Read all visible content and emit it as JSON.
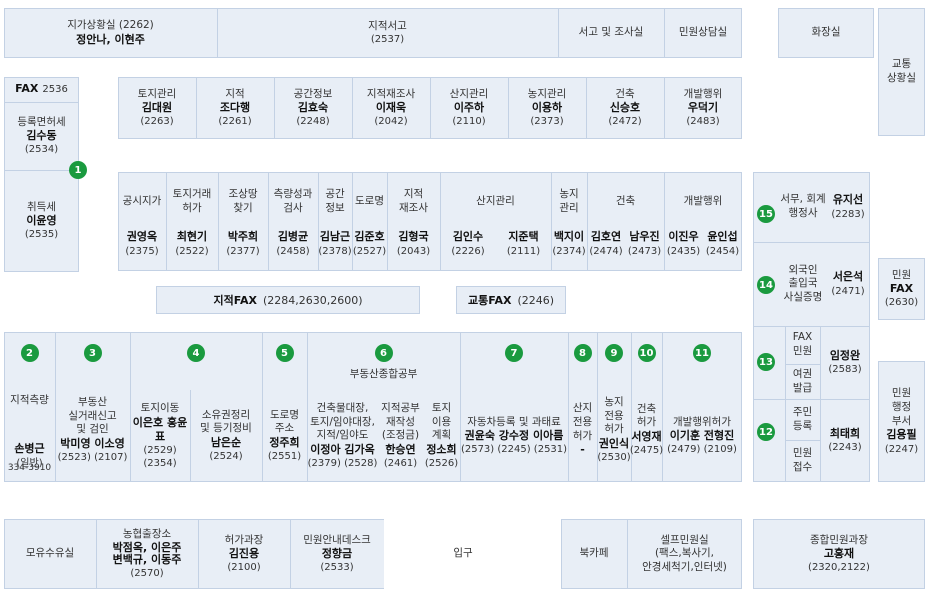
{
  "top": {
    "c1": {
      "label": "지가상황실 (2262)",
      "names": "정안나, 이현주"
    },
    "c2": {
      "label": "지적서고",
      "phone": "(2537)"
    },
    "c3": {
      "label": "서고 및 조사실"
    },
    "c4": {
      "label": "민원상담실"
    },
    "restroom": "화장실",
    "traffic": "교통\n상황실"
  },
  "left": {
    "fax": {
      "title": "FAX",
      "num": "2536"
    },
    "reg": {
      "label": "등록면허세",
      "name": "김수동",
      "phone": "(2534)"
    },
    "acq": {
      "label": "취득세",
      "name": "이윤영",
      "phone": "(2535)"
    },
    "badge": "1"
  },
  "row2": [
    {
      "label": "토지관리",
      "name": "김대원",
      "phone": "(2263)"
    },
    {
      "label": "지적",
      "name": "조다행",
      "phone": "(2261)"
    },
    {
      "label": "공간정보",
      "name": "김효숙",
      "phone": "(2248)"
    },
    {
      "label": "지적재조사",
      "name": "이재욱",
      "phone": "(2042)"
    },
    {
      "label": "산지관리",
      "name": "이주하",
      "phone": "(2110)"
    },
    {
      "label": "농지관리",
      "name": "이용하",
      "phone": "(2373)"
    },
    {
      "label": "건축",
      "name": "신승호",
      "phone": "(2472)"
    },
    {
      "label": "개발행위",
      "name": "우덕기",
      "phone": "(2483)"
    }
  ],
  "row3": {
    "heads": [
      "공시지가",
      "토지거래\n허가",
      "조상땅\n찾기",
      "측량성과\n검사",
      "공간\n정보",
      "도로명",
      "지적\n재조사",
      "산지관리",
      "농지\n관리",
      "건축",
      "개발행위"
    ],
    "names": [
      "권영옥",
      "최현기",
      "박주희",
      "김병균",
      "김남근",
      "김준호",
      "김형국",
      "김인수",
      "지준택",
      "백지이",
      "김호연",
      "남우진",
      "이진우",
      "윤인섭"
    ],
    "phones": [
      "(2375)",
      "(2522)",
      "(2377)",
      "(2458)",
      "(2378)",
      "(2527)",
      "(2043)",
      "(2226)",
      "(2111)",
      "(2374)",
      "(2474)",
      "(2473)",
      "(2435)",
      "(2454)"
    ]
  },
  "faxbar": {
    "jijeok": {
      "title": "지적FAX",
      "num": "(2284,2630,2600)"
    },
    "traffic": {
      "title": "교통FAX",
      "num": "(2246)"
    }
  },
  "right": {
    "r15": {
      "badge": "15",
      "label": "서무, 회계\n행정사",
      "name": "유지선",
      "phone": "(2283)"
    },
    "r14": {
      "badge": "14",
      "label": "외국인\n출입국\n사실증명",
      "name": "서은석",
      "phone": "(2471)"
    },
    "r13": {
      "badge": "13",
      "label1": "FAX\n민원",
      "label2": "여권\n발급",
      "name": "임정완",
      "phone": "(2583)"
    },
    "r12": {
      "badge": "12",
      "label1": "주민\n등록",
      "label2": "민원\n접수",
      "name": "최태희",
      "phone": "(2243)"
    },
    "fax": {
      "label": "민원",
      "title": "FAX",
      "num": "(2630)"
    },
    "admin": {
      "label": "민원\n행정\n부서",
      "name": "김용필",
      "phone": "(2247)"
    }
  },
  "row4": {
    "badges": [
      "2",
      "3",
      "4",
      "5",
      "6",
      "7",
      "8",
      "9",
      "10",
      "11"
    ],
    "survey": {
      "label": "지적측량",
      "name": "손병근",
      "sub": "(일반)",
      "phone": "334-3910"
    },
    "realty": {
      "label": "부동산\n실거래신고\n및 검인",
      "names": "박미영 이소영",
      "phones": "(2523) (2107)"
    },
    "land": {
      "label": "토지이동",
      "names": "이은호 홍윤표",
      "phones": "(2529) (2354)"
    },
    "own": {
      "label": "소유권정리\n및 등기정비",
      "name": "남은순",
      "phone": "(2524)"
    },
    "road": {
      "label": "도로명\n주소",
      "name": "정주희",
      "phone": "(2551)"
    },
    "public": {
      "title": "부동산종합공부",
      "a": {
        "label": "건축물대장,\n토지/임야대장,\n지적/임야도",
        "names": "이정아 김가옥",
        "phones": "(2379) (2528)"
      },
      "b": {
        "label": "지적공부\n재작성\n(조정금)",
        "name": "한승연",
        "phone": "(2461)"
      },
      "c": {
        "label": "토지\n이용\n계획",
        "name": "정소희",
        "phone": "(2526)"
      }
    },
    "car": {
      "label": "자동차등록 및 과태료",
      "names": "권윤숙 강수정 이아름",
      "phones": "(2573) (2245) (2531)"
    },
    "mount": {
      "label": "산지\n전용\n허가",
      "name": "-"
    },
    "farm": {
      "label": "농지\n전용\n허가",
      "name": "권인식",
      "phone": "(2530)"
    },
    "build": {
      "label": "건축\n허가",
      "name": "서영재",
      "phone": "(2475)"
    },
    "dev": {
      "label": "개발행위허가",
      "names": "이기훈 전형진",
      "phones": "(2479) (2109)"
    }
  },
  "bottom": {
    "nursing": "모유수유실",
    "agri": {
      "label": "농협출장소",
      "names": "박점옥, 이은주\n변백규, 이동주",
      "phone": "(2570)"
    },
    "permit": {
      "label": "허가과장",
      "name": "김진용",
      "phone": "(2100)"
    },
    "info": {
      "label": "민원안내데스크",
      "name": "정향금",
      "phone": "(2533)"
    },
    "entrance": "입구",
    "cafe": "북카페",
    "self": {
      "label": "셀프민원실",
      "sub": "(팩스,복사기,\n안경세척기,인터넷)"
    },
    "chief": {
      "label": "종합민원과장",
      "name": "고홍재",
      "phone": "(2320,2122)"
    }
  }
}
